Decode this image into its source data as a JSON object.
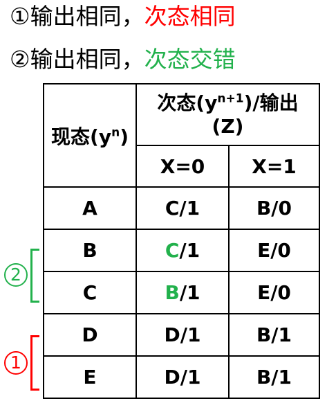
{
  "rules": [
    {
      "marker": "①",
      "prefix": "输出相同，",
      "highlight": "次态相同",
      "highlight_color": "#ff0000"
    },
    {
      "marker": "②",
      "prefix": "输出相同，",
      "highlight": "次态交错",
      "highlight_color": "#22b14c"
    }
  ],
  "table": {
    "current_state_header": "现态(y",
    "current_state_sup": "n",
    "current_state_close": ")",
    "next_state_header_a": "次态(y",
    "next_state_sup": "n+1",
    "next_state_header_b": ")/输出",
    "next_state_header_c": "(Z)",
    "input_columns": [
      "X=0",
      "X=1"
    ],
    "rows": [
      {
        "state": "A",
        "x0_next": "C",
        "x0_out": "/1",
        "x1": "B/0",
        "x0_highlight": false
      },
      {
        "state": "B",
        "x0_next": "C",
        "x0_out": "/1",
        "x1": "E/0",
        "x0_highlight": true
      },
      {
        "state": "C",
        "x0_next": "B",
        "x0_out": "/1",
        "x1": "E/0",
        "x0_highlight": true
      },
      {
        "state": "D",
        "x0_next": "D",
        "x0_out": "/1",
        "x1": "B/1",
        "x0_highlight": false
      },
      {
        "state": "E",
        "x0_next": "D",
        "x0_out": "/1",
        "x1": "B/1",
        "x0_highlight": false
      }
    ]
  },
  "groups": [
    {
      "marker": "②",
      "color": "#22b14c",
      "states": [
        "B",
        "C"
      ]
    },
    {
      "marker": "①",
      "color": "#ff0000",
      "states": [
        "D",
        "E"
      ]
    }
  ]
}
